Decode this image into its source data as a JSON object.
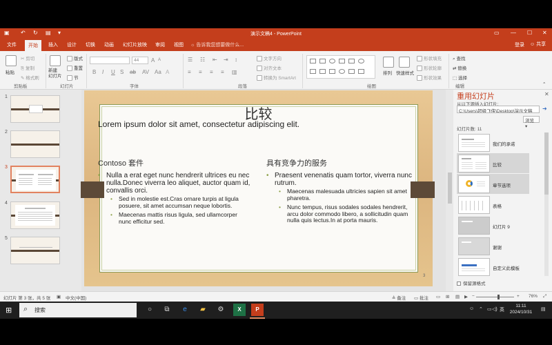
{
  "window": {
    "title": "演示文稿4 - PowerPoint",
    "controls": [
      "▭",
      "—",
      "☐",
      "✕"
    ]
  },
  "quick_access": [
    "▣",
    "↶",
    "↻",
    "▤",
    "▾"
  ],
  "tabs": [
    "文件",
    "开始",
    "插入",
    "设计",
    "切换",
    "动画",
    "幻灯片放映",
    "审阅",
    "视图"
  ],
  "active_tab": "开始",
  "tell_me": "告诉我您想要做什么...",
  "account": {
    "sign_in": "登录",
    "share": "共享"
  },
  "ribbon": {
    "clipboard": {
      "label": "剪贴板",
      "paste": "粘贴",
      "cut": "剪切",
      "copy": "复制",
      "format_painter": "格式刷"
    },
    "slides": {
      "label": "幻灯片",
      "new_slide": "新建\n幻灯片",
      "layout": "版式",
      "reset": "重置",
      "section": "节"
    },
    "font": {
      "label": "字体",
      "size": "44"
    },
    "paragraph": {
      "label": "段落",
      "text_direction": "文字方向",
      "align_text": "对齐文本",
      "smartart": "转换为 SmartArt"
    },
    "drawing": {
      "label": "绘图",
      "arrange": "排列",
      "quick_styles": "快速样式",
      "shape_fill": "形状填充",
      "shape_outline": "形状轮廓",
      "shape_effects": "形状效果"
    },
    "editing": {
      "label": "编辑",
      "find": "查找",
      "replace": "替换",
      "select": "选择"
    }
  },
  "thumbnails": {
    "numbers": [
      "1",
      "2",
      "3",
      "4",
      "5"
    ],
    "active_index": 2
  },
  "slide": {
    "title": "比较",
    "subtitle": "Lorem ipsum dolor sit amet, consectetur adipiscing elit.",
    "left": {
      "heading": "Contoso 套件",
      "bullet": "Nulla a erat eget nunc hendrerit ultrices eu nec nulla.Donec viverra leo aliquet, auctor quam id, convallis orci.",
      "sub_bullets": [
        "Sed in molestie est.Cras ornare turpis at ligula posuere, sit amet accumsan neque lobortis.",
        "Maecenas mattis risus ligula, sed ullamcorper nunc efficitur sed."
      ]
    },
    "right": {
      "heading": "具有竞争力的服务",
      "bullet": "Praesent venenatis quam tortor, viverra nunc rutrum.",
      "sub_bullets": [
        "Maecenas malesuada ultricies sapien sit amet pharetra.",
        "Nunc tempus, risus sodales sodales hendrerit, arcu dolor commodo libero, a sollicitudin quam nulla quis lectus.In at porta mauris."
      ]
    },
    "number": "3"
  },
  "reuse_pane": {
    "title": "重用幻灯片",
    "close": "✕",
    "insert_from": "从以下源插入幻灯片:",
    "path": "C:\\Users\\超级飞侠\\Desktop\\演示文稿",
    "go": "➜",
    "browse": "浏览",
    "slide_count": "幻灯片数: 11",
    "slides": [
      "我们的承诺",
      "比较",
      "章节选项",
      "表格",
      "幻灯片 9",
      "谢谢",
      "自定义此模板"
    ],
    "keep_formatting": "保留源格式"
  },
  "status_bar": {
    "slide_info": "幻灯片 第 3 张，共 5 张",
    "language": "中文(中国)",
    "notes": "备注",
    "comments": "批注",
    "zoom": "76%"
  },
  "taskbar": {
    "search": "搜索",
    "ime": "英",
    "time": "11:11",
    "date": "2024/10/31"
  },
  "colors": {
    "accent": "#c43e1c",
    "slide_frame": "#8b9a55",
    "bullet": "#8ea24a"
  }
}
